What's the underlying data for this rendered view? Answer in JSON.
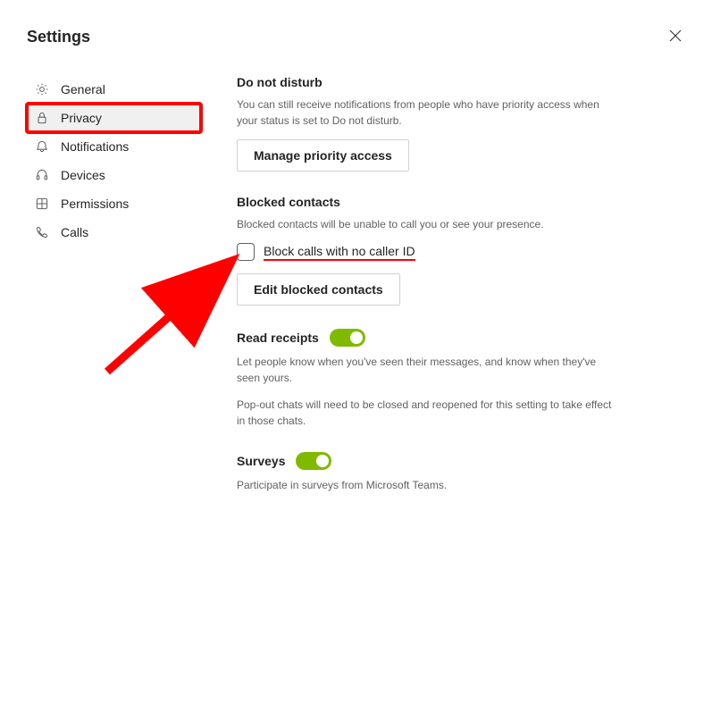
{
  "header": {
    "title": "Settings"
  },
  "sidebar": {
    "items": [
      {
        "label": "General"
      },
      {
        "label": "Privacy"
      },
      {
        "label": "Notifications"
      },
      {
        "label": "Devices"
      },
      {
        "label": "Permissions"
      },
      {
        "label": "Calls"
      }
    ]
  },
  "content": {
    "dnd": {
      "title": "Do not disturb",
      "desc": "You can still receive notifications from people who have priority access when your status is set to Do not disturb.",
      "button": "Manage priority access"
    },
    "blocked": {
      "title": "Blocked contacts",
      "desc": "Blocked contacts will be unable to call you or see your presence.",
      "checkbox_label": "Block calls with no caller ID",
      "button": "Edit blocked contacts"
    },
    "readreceipts": {
      "title": "Read receipts",
      "desc": "Let people know when you've seen their messages, and know when they've seen yours.",
      "desc2": "Pop-out chats will need to be closed and reopened for this setting to take effect in those chats."
    },
    "surveys": {
      "title": "Surveys",
      "desc": "Participate in surveys from Microsoft Teams."
    }
  }
}
